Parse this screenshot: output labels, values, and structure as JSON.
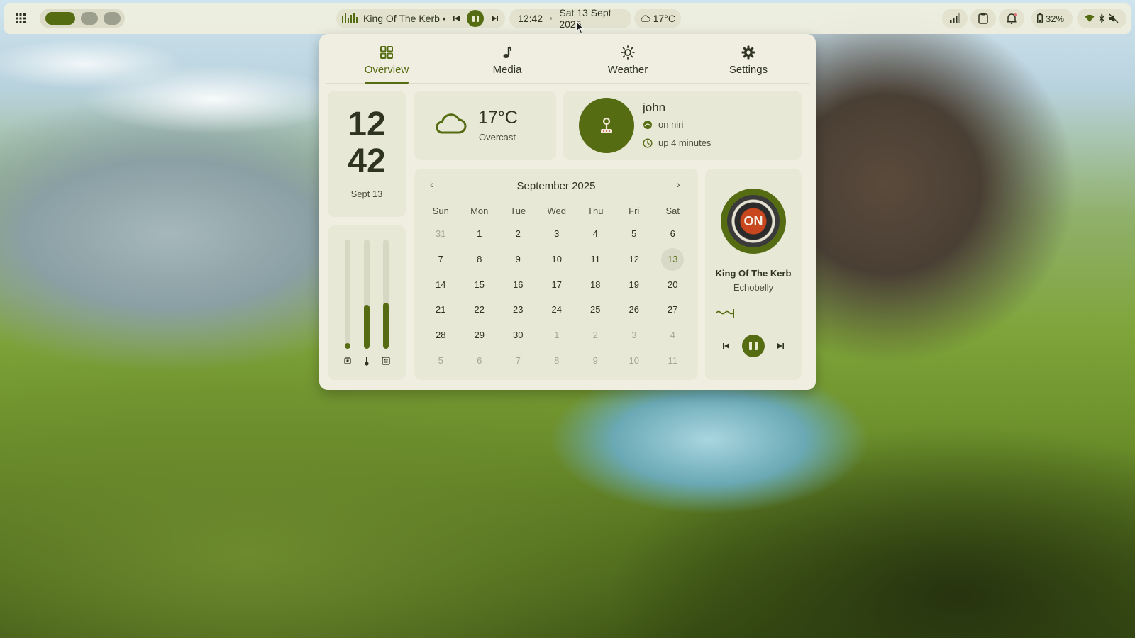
{
  "topbar": {
    "media_title": "King Of The Kerb • Echobelly",
    "clock": "12:42",
    "date": "Sat 13 Sept 2025",
    "weather_temp": "17°C",
    "battery": "32%"
  },
  "tabs": [
    {
      "label": "Overview",
      "icon": "overview-grid-icon"
    },
    {
      "label": "Media",
      "icon": "music-note-icon"
    },
    {
      "label": "Weather",
      "icon": "sun-icon"
    },
    {
      "label": "Settings",
      "icon": "gear-icon"
    }
  ],
  "active_tab": "Overview",
  "clock": {
    "hour": "12",
    "minute": "42",
    "date": "Sept 13"
  },
  "sliders": [
    {
      "icon": "cpu-icon",
      "level": 0.05
    },
    {
      "icon": "thermometer-icon",
      "level": 0.4
    },
    {
      "icon": "memory-icon",
      "level": 0.42
    }
  ],
  "weather": {
    "temp": "17°C",
    "condition": "Overcast",
    "icon": "cloud-icon"
  },
  "user": {
    "name": "john",
    "wm": "on niri",
    "uptime": "up 4 minutes"
  },
  "calendar": {
    "title": "September 2025",
    "prev": "‹",
    "next": "›",
    "weekdays": [
      "Sun",
      "Mon",
      "Tue",
      "Wed",
      "Thu",
      "Fri",
      "Sat"
    ],
    "weeks": [
      [
        "31",
        "1",
        "2",
        "3",
        "4",
        "5",
        "6"
      ],
      [
        "7",
        "8",
        "9",
        "10",
        "11",
        "12",
        "13"
      ],
      [
        "14",
        "15",
        "16",
        "17",
        "18",
        "19",
        "20"
      ],
      [
        "21",
        "22",
        "23",
        "24",
        "25",
        "26",
        "27"
      ],
      [
        "28",
        "29",
        "30",
        "1",
        "2",
        "3",
        "4"
      ],
      [
        "5",
        "6",
        "7",
        "8",
        "9",
        "10",
        "11"
      ]
    ],
    "today": "13"
  },
  "player": {
    "track": "King Of The Kerb",
    "artist": "Echobelly",
    "album_text": "ON",
    "progress": 0.22
  },
  "colors": {
    "accent": "#566c13",
    "panel": "#efeee0",
    "card": "#e8e8d6",
    "text": "#2f3322"
  }
}
